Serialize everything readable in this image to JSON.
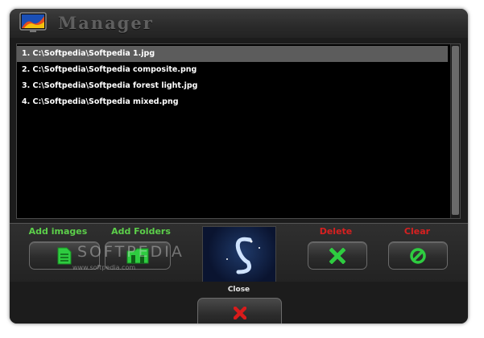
{
  "window": {
    "title": "Manager"
  },
  "file_list": {
    "items": [
      "1. C:\\Softpedia\\Softpedia 1.jpg",
      "2. C:\\Softpedia\\Softpedia composite.png",
      "3. C:\\Softpedia\\Softpedia forest light.jpg",
      "4. C:\\Softpedia\\Softpedia mixed.png"
    ],
    "selected_index": 0
  },
  "actions": {
    "add_images_label": "Add images",
    "add_folders_label": "Add Folders",
    "delete_label": "Delete",
    "clear_label": "Clear"
  },
  "footer": {
    "close_label": "Close"
  },
  "watermark": {
    "main": "SOFTPEDIA",
    "sub": "www.softpedia.com"
  },
  "colors": {
    "green_label": "#5ccf4a",
    "red_label": "#d82020",
    "accent_green_icon": "#2ecc40",
    "close_x": "#d81b1b"
  },
  "icons": {
    "app": "monitor-gradient-icon",
    "add_images": "document-green-icon",
    "add_folders": "folder-green-icon",
    "delete": "x-green-icon",
    "clear": "circle-slash-green-icon",
    "close": "x-red-icon"
  }
}
